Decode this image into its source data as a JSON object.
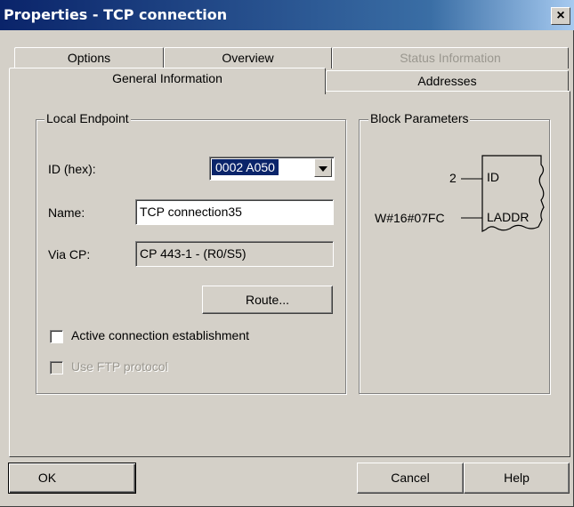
{
  "window": {
    "title": "Properties - TCP connection",
    "close_label": "×"
  },
  "tabs": {
    "options": "Options",
    "overview": "Overview",
    "status_information": "Status Information",
    "general_information": "General Information",
    "addresses": "Addresses"
  },
  "local_endpoint": {
    "group_label": "Local Endpoint",
    "id_label": "ID (hex):",
    "id_value": "0002 A050",
    "name_label": "Name:",
    "name_value": "TCP connection35",
    "via_cp_label": "Via CP:",
    "via_cp_value": "CP 443-1 - (R0/S5)",
    "route_label": "Route...",
    "active_connection_label": "Active connection establishment",
    "active_connection_checked": false,
    "use_ftp_label": "Use FTP protocol",
    "use_ftp_checked": false
  },
  "block_parameters": {
    "group_label": "Block Parameters",
    "id_input_value": "2",
    "id_pin": "ID",
    "laddr_input_value": "W#16#07FC",
    "laddr_pin": "LADDR"
  },
  "footer": {
    "ok_label": "OK",
    "cancel_label": "Cancel",
    "help_label": "Help"
  },
  "icons": {
    "dropdown": "chevron-down-icon",
    "close": "close-icon"
  }
}
